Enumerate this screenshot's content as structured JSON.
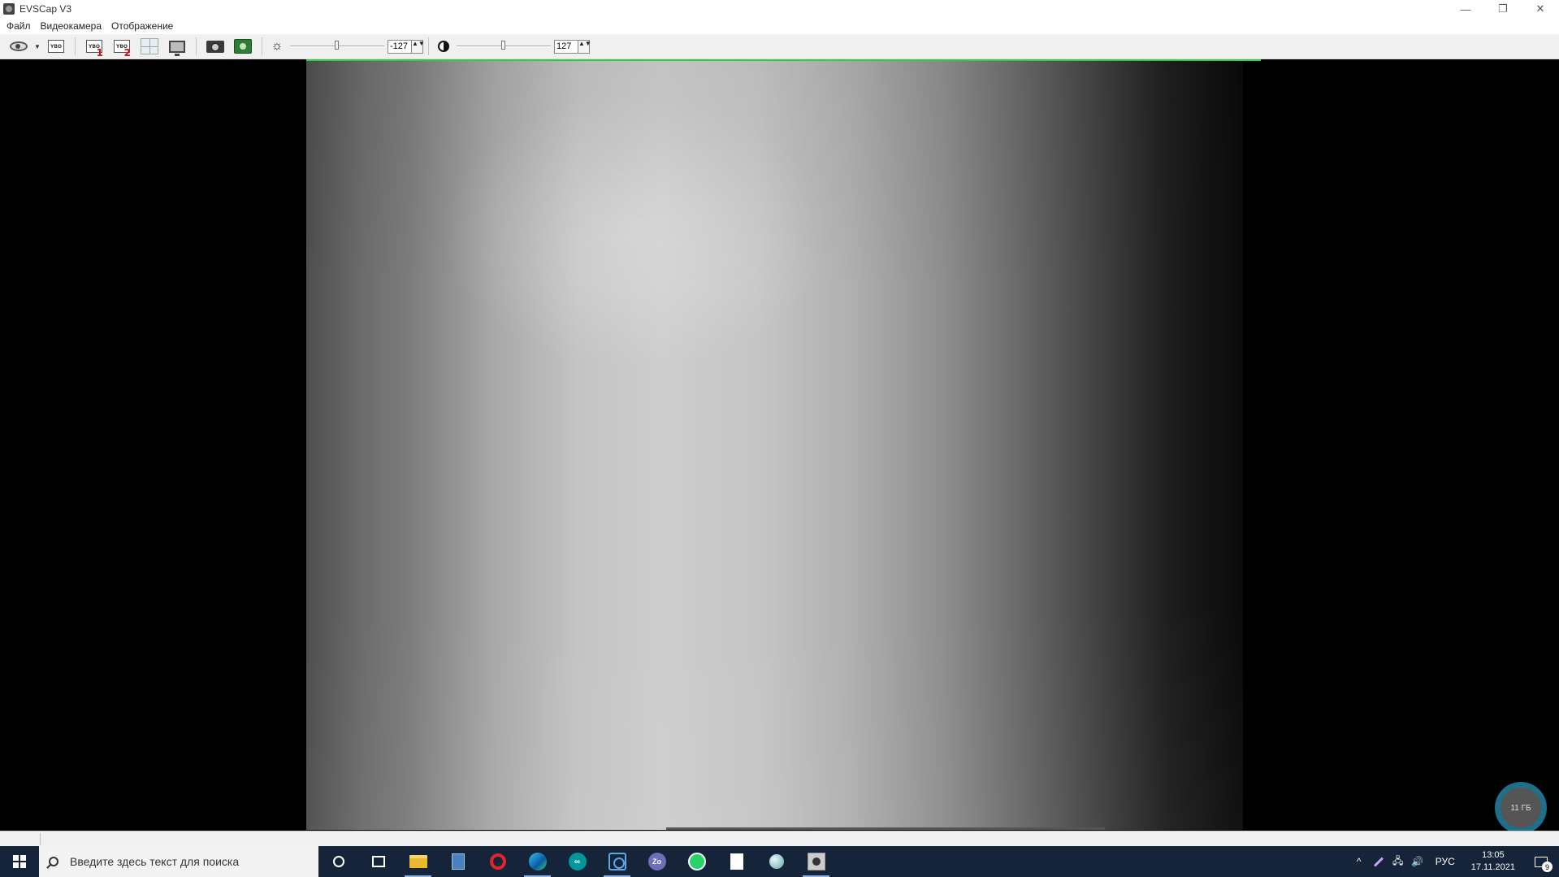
{
  "window": {
    "title": "EVSCap V3",
    "controls": {
      "minimize": "—",
      "restore": "❐",
      "close": "✕"
    }
  },
  "menu": [
    "Файл",
    "Видеокамера",
    "Отображение"
  ],
  "toolbar": {
    "video1_label": "YBO",
    "video1_index": "1",
    "video2_label": "YBO",
    "video2_index": "2",
    "source_label": "YBO",
    "brightness": {
      "value": "-127",
      "icon": "sun-icon",
      "slider_level": 0.5
    },
    "contrast": {
      "value": "127",
      "icon": "contrast-icon",
      "slider_level": 0.5
    },
    "spin_arrows": "▲▼"
  },
  "disk_badge": "11 ГБ",
  "taskbar": {
    "search_placeholder": "Введите здесь текст для поиска",
    "apps": [
      "cortana",
      "task-view",
      "file-explorer",
      "calculator",
      "opera",
      "edge",
      "arduino",
      "network-app",
      "zoom",
      "whatsapp",
      "document",
      "sphere-app",
      "evscap"
    ],
    "arduino_label": "∞",
    "zoom_label": "Zo",
    "tray": {
      "chevron": "^",
      "network": "🖧",
      "volume": "🔊",
      "language": "РУС",
      "time": "13:05",
      "date": "17.11.2021",
      "notifications_count": "9"
    }
  },
  "colors": {
    "accent_green": "#2ecc40",
    "taskbar_bg": "#16243a",
    "disk_badge_ring": "#1f6f8b"
  }
}
